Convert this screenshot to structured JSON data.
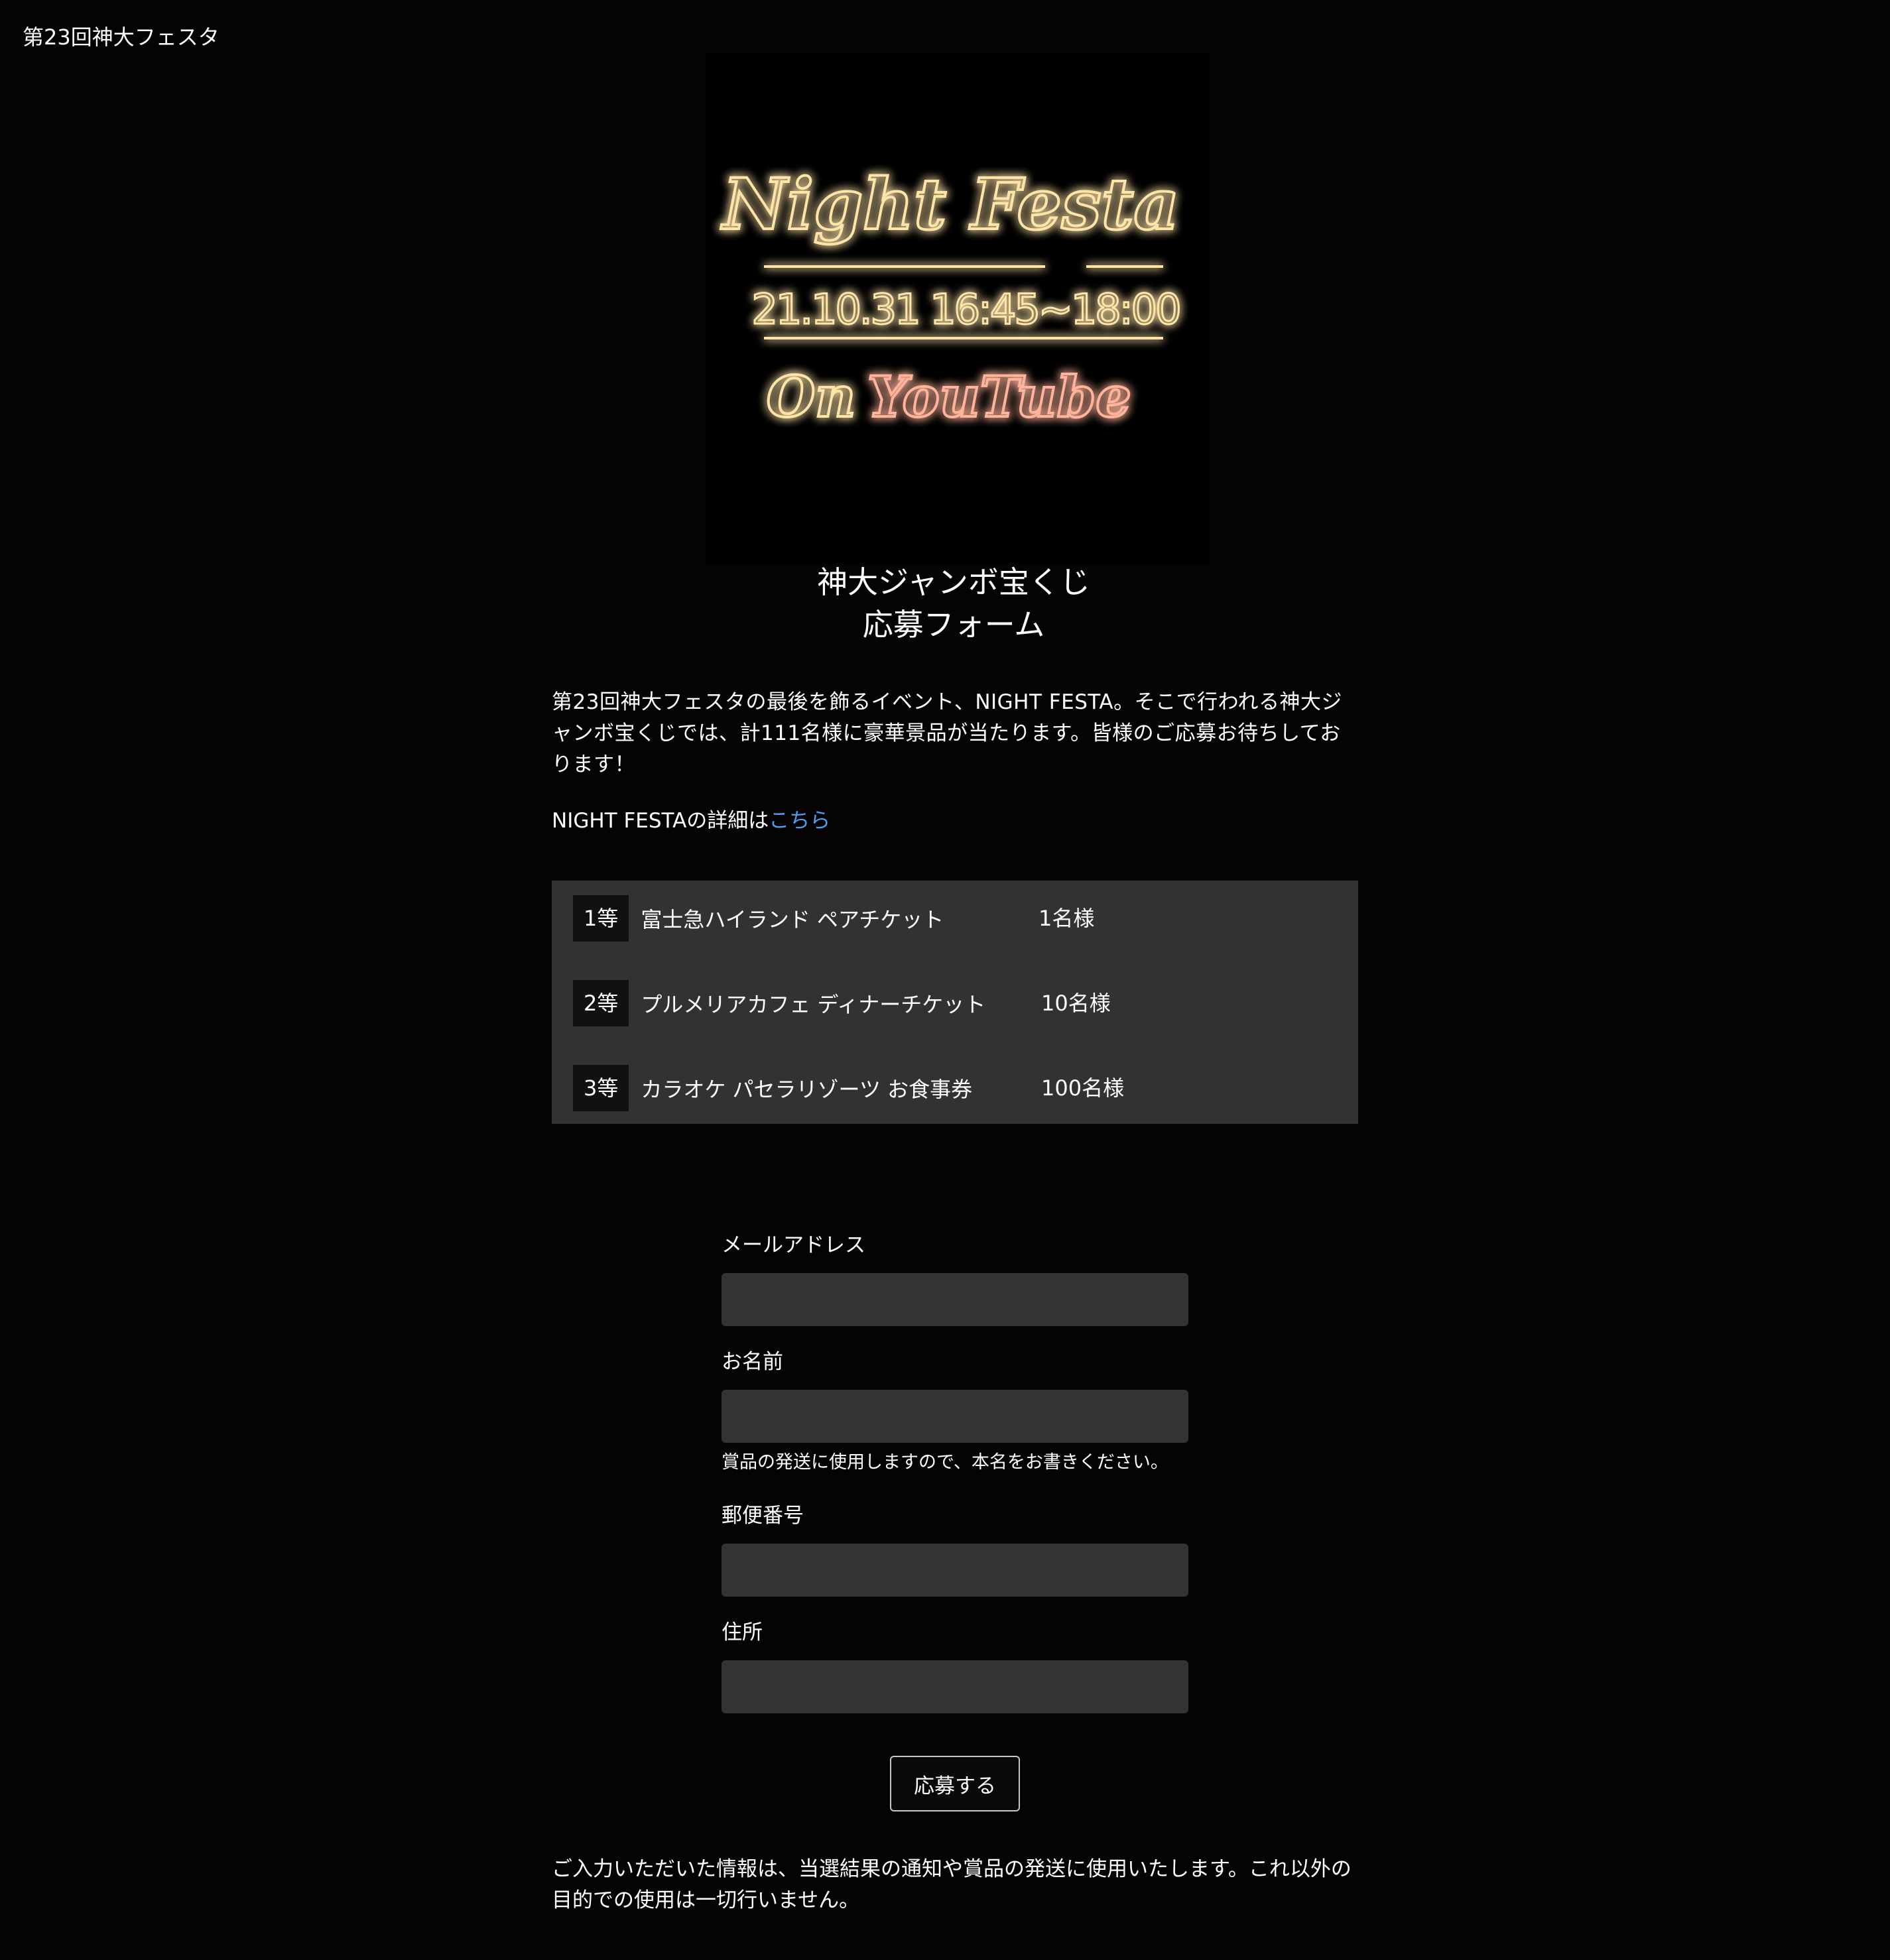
{
  "header": {
    "site_name": "第23回神大フェスタ"
  },
  "hero": {
    "line1": "Night Festa",
    "line2": "21.10.31 16:45~18:00",
    "line3_a": "On",
    "line3_b": "YouTube",
    "colors": {
      "glow": "#ffb648",
      "text": "#ffe9b5",
      "youtube": "#ff9d7a"
    }
  },
  "title": {
    "line1": "神大ジャンボ宝くじ",
    "line2": "応募フォーム"
  },
  "intro": {
    "text": "第23回神大フェスタの最後を飾るイベント、NIGHT FESTA。そこで行われる神大ジャンボ宝くじでは、計111名様に豪華景品が当たります。皆様のご応募お待ちしております！"
  },
  "detail": {
    "prefix": "NIGHT FESTAの詳細は",
    "link_label": "こちら"
  },
  "prizes": [
    {
      "rank": "1等",
      "name": "富士急ハイランド ペアチケット",
      "count": "1名様"
    },
    {
      "rank": "2等",
      "name": "プルメリアカフェ ディナーチケット",
      "count": "10名様"
    },
    {
      "rank": "3等",
      "name": "カラオケ パセラリゾーツ お食事券",
      "count": "100名様"
    }
  ],
  "form": {
    "email_label": "メールアドレス",
    "email_value": "",
    "name_label": "お名前",
    "name_value": "",
    "name_hint": "賞品の発送に使用しますので、本名をお書きください。",
    "postal_label": "郵便番号",
    "postal_value": "",
    "address_label": "住所",
    "address_value": "",
    "submit_label": "応募する"
  },
  "privacy": {
    "text": "ご入力いただいた情報は、当選結果の通知や賞品の発送に使用いたします。これ以外の目的での使用は一切行いません。"
  },
  "colors": {
    "background": "#050304",
    "panel": "#323232",
    "input": "#333333",
    "link": "#4f9cf0"
  }
}
